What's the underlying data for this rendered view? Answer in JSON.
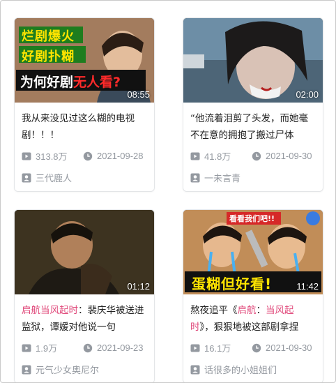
{
  "colors": {
    "highlight": "#e0487a",
    "meta": "#9499a0"
  },
  "cards": [
    {
      "thumb_text": [
        "烂剧爆火",
        "好剧扑糊",
        "为何好剧",
        "无人看?"
      ],
      "duration": "08:55",
      "title": "我从来没见过这么糊的电视剧！！！",
      "views": "313.8万",
      "date": "2021-09-28",
      "uploader": "三代鹿人"
    },
    {
      "duration": "02:00",
      "title": "“他流着泪剪了头发，而她毫不在意的拥抱了搬过尸体",
      "views": "41.8万",
      "date": "2021-09-30",
      "uploader": "一未言青"
    },
    {
      "duration": "01:12",
      "title_hl": "启航当风起时",
      "title_rest": "：裴庆华被送进监狱，谭媛对他说一句",
      "views": "1.9万",
      "date": "2021-09-23",
      "uploader": "元气少女奥尼尔"
    },
    {
      "thumb_text": [
        "看看我们吧!!",
        "蛋糊但好看!"
      ],
      "duration": "11:42",
      "title_pre": "熬夜追平《",
      "title_hl1": "启航",
      "title_mid": "：",
      "title_hl2": "当风起时",
      "title_rest": "》，狠狠地被这部剧拿捏",
      "views": "16.1万",
      "date": "2021-09-30",
      "uploader": "话很多的小姐姐们"
    }
  ]
}
